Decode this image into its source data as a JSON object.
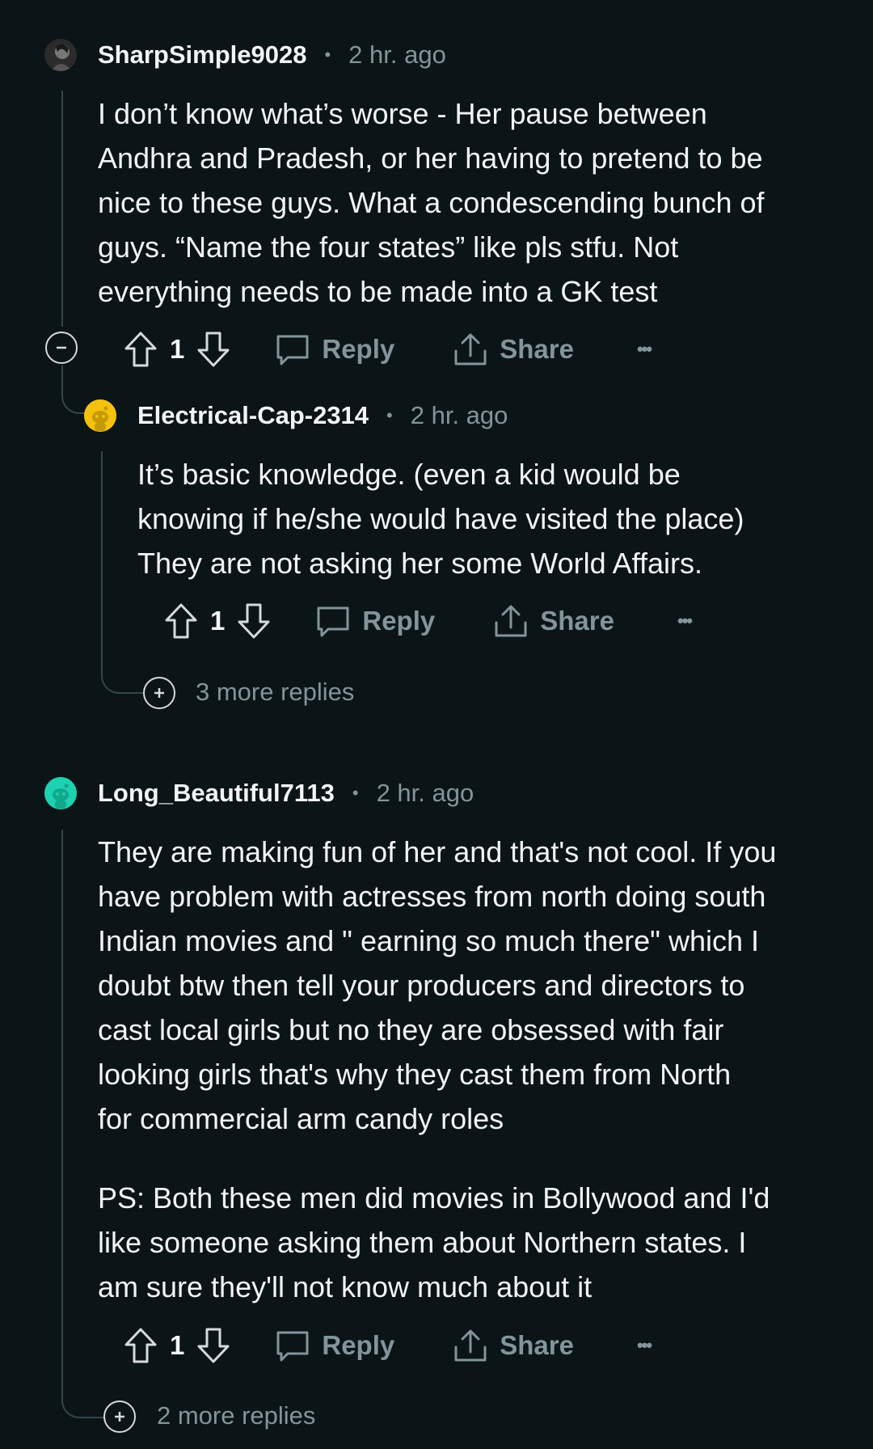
{
  "comments": [
    {
      "username": "SharpSimple9028",
      "separator": "•",
      "time": "2 hr. ago",
      "body_lines": [
        "I don’t know what’s worse - Her pause between",
        "Andhra and Pradesh, or her having to pretend to be",
        "nice to these guys. What a condescending bunch of",
        "guys. “Name the four states” like pls stfu. Not",
        "everything needs to be made into a GK test"
      ],
      "score": "1",
      "reply_label": "Reply",
      "share_label": "Share",
      "more_label": "•••"
    },
    {
      "username": "Electrical-Cap-2314",
      "separator": "•",
      "time": "2 hr. ago",
      "body_lines": [
        "It’s basic knowledge. (even a kid would be",
        "knowing if he/she would have visited the place)",
        "They are not asking her some World Affairs."
      ],
      "score": "1",
      "reply_label": "Reply",
      "share_label": "Share",
      "more_label": "•••",
      "more_replies": "3 more replies"
    },
    {
      "username": "Long_Beautiful7113",
      "separator": "•",
      "time": "2 hr. ago",
      "body_lines": [
        "They are making fun of her and that's not cool. If you",
        "have problem with actresses from north doing south",
        "Indian movies and \" earning so much there\" which I",
        "doubt btw then tell your producers and directors to",
        "cast local girls but no they are obsessed with fair",
        "looking girls that's why they cast them from North",
        "for commercial arm candy roles"
      ],
      "body_lines_2": [
        "PS: Both these men did movies in Bollywood and I'd",
        "like someone asking them about Northern states. I",
        "am sure they'll not know much about it"
      ],
      "score": "1",
      "reply_label": "Reply",
      "share_label": "Share",
      "more_label": "•••",
      "more_replies": "2 more replies"
    }
  ],
  "colors": {
    "background": "#0b1416",
    "text": "#f2f4f5",
    "muted": "#82959b",
    "thread_line": "#33464c",
    "avatar2": "#f4c20d",
    "avatar3": "#1ed1b0"
  }
}
